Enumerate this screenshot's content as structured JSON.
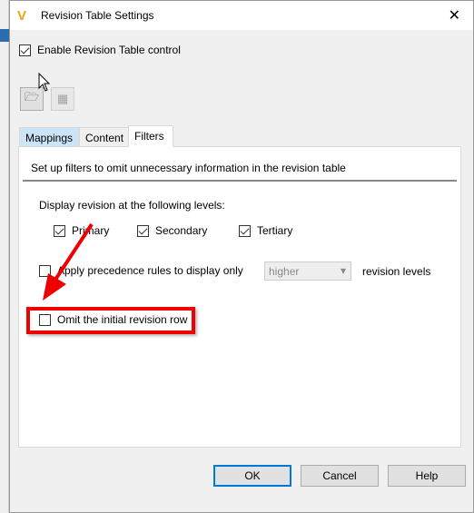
{
  "window": {
    "title": "Revision Table Settings",
    "close": "✕"
  },
  "enable_control": {
    "label": "Enable Revision Table control",
    "checked": true
  },
  "toolbar": [
    {
      "icon": "folder-settings-icon",
      "enabled": true
    },
    {
      "icon": "table-import-icon",
      "enabled": false
    }
  ],
  "tabs": [
    {
      "label": "Mappings"
    },
    {
      "label": "Content"
    },
    {
      "label": "Filters",
      "active": true
    }
  ],
  "filters": {
    "description": "Set up filters to omit unnecessary information in the revision table",
    "levels_label": "Display revision at the following levels:",
    "levels": [
      {
        "label": "Primary",
        "checked": true
      },
      {
        "label": "Secondary",
        "checked": true
      },
      {
        "label": "Tertiary",
        "checked": true
      }
    ],
    "precedence": {
      "label": "Apply precedence rules to display only",
      "checked": false,
      "select_value": "higher",
      "suffix": "revision levels"
    },
    "omit_initial": {
      "label": "Omit the initial revision row",
      "checked": false
    }
  },
  "buttons": {
    "ok": "OK",
    "cancel": "Cancel",
    "help": "Help"
  },
  "annotation_color": "#e00000"
}
